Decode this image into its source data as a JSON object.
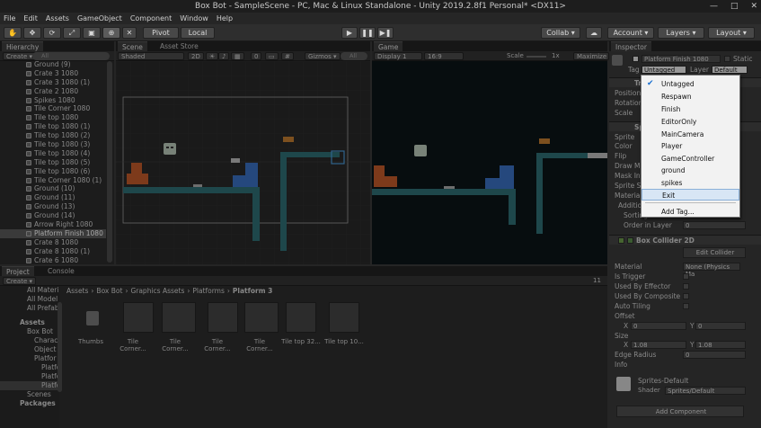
{
  "window": {
    "title": "Box Bot - SampleScene - PC, Mac & Linux Standalone - Unity 2019.2.8f1 Personal* <DX11>",
    "controls": [
      "—",
      "□",
      "✕"
    ]
  },
  "menu": [
    "File",
    "Edit",
    "Assets",
    "GameObject",
    "Component",
    "Window",
    "Help"
  ],
  "toolbar": {
    "pivot": "Pivot",
    "local": "Local",
    "collab": "Collab ▾",
    "account": "Account ▾",
    "layers": "Layers ▾",
    "layout": "Layout ▾",
    "cloud_icon": "cloud-icon"
  },
  "hierarchy": {
    "tab": "Hierarchy",
    "create": "Create ▾",
    "search_placeholder": "All",
    "items": [
      "Ground (9)",
      "Crate 3 1080",
      "Crate 3 1080 (1)",
      "Crate 2 1080",
      "Spikes 1080",
      "Tile Corner 1080",
      "Tile top 1080",
      "Tile top 1080 (1)",
      "Tile top 1080 (2)",
      "Tile top 1080 (3)",
      "Tile top 1080 (4)",
      "Tile top 1080 (5)",
      "Tile top 1080 (6)",
      "Tile Corner 1080 (1)",
      "Ground (10)",
      "Ground (11)",
      "Ground (13)",
      "Ground (14)",
      "Arrow Right 1080",
      "Platform Finish 1080",
      "Crate 8 1080",
      "Crate 8 1080 (1)",
      "Crate 6 1080"
    ],
    "selected_index": 19
  },
  "scene": {
    "tab": "Scene",
    "asset_store_tab": "Asset Store",
    "shading": "Shaded",
    "mode_2d": "2D",
    "gizmos": "Gizmos ▾",
    "search_placeholder": "All"
  },
  "game": {
    "tab": "Game",
    "display": "Display 1",
    "aspect": "16:9",
    "scale_label": "Scale",
    "scale_value": "1x",
    "maximize": "Maximize o"
  },
  "inspector": {
    "tab": "Inspector",
    "object_name": "Platform Finish 1080",
    "static_label": "Static",
    "tag_label": "Tag",
    "tag_value": "Untagged",
    "layer_label": "Layer",
    "layer_value": "Default",
    "transform_header": "Tr",
    "transform_rows": [
      "Position",
      "Rotation",
      "Scale"
    ],
    "sprite_header": "Sprit",
    "sprite_rows": [
      "Sprite",
      "Color",
      "Flip",
      "Draw Mo",
      "Mask Int",
      "Sprite S",
      "Material"
    ],
    "additional_label": "Additio",
    "sorting_label": "Sorting",
    "order_label": "Order in Layer",
    "order_value": "0",
    "box_collider_header": "Box Collider 2D",
    "edit_collider": "Edit Collider",
    "material_label": "Material",
    "material_value": "None (Physics Ma",
    "is_trigger": "Is Trigger",
    "used_by_effector": "Used By Effector",
    "used_by_composite": "Used By Composite",
    "auto_tiling": "Auto Tiling",
    "offset_label": "Offset",
    "offset_x": "0",
    "offset_y": "0",
    "size_label": "Size",
    "size_x": "1.08",
    "size_y": "1.08",
    "edge_radius_label": "Edge Radius",
    "edge_radius_value": "0",
    "info_label": "Info",
    "material_name": "Sprites-Default",
    "shader_label": "Shader",
    "shader_value": "Sprites/Default",
    "add_component": "Add Component"
  },
  "tag_dropdown": {
    "items": [
      "Untagged",
      "Respawn",
      "Finish",
      "EditorOnly",
      "MainCamera",
      "Player",
      "GameController",
      "ground",
      "spikes",
      "Exit",
      "Add Tag..."
    ],
    "checked_index": 0,
    "highlighted_index": 9
  },
  "project": {
    "tab": "Project",
    "console_tab": "Console",
    "create": "Create ▾",
    "favorites": [
      "All Materi",
      "All Model",
      "All Prefab"
    ],
    "tree": [
      "Assets",
      "Box Bot",
      "Charac",
      "Object",
      "Platfor",
      "Platfo",
      "Platfo",
      "Platfo",
      "Scenes",
      "Packages"
    ],
    "breadcrumb": [
      "Assets",
      "Box Bot",
      "Graphics Assets",
      "Platforms",
      "Platform 3"
    ],
    "count": "11",
    "assets": [
      "Thumbs",
      "Tile Corner...",
      "Tile Corner...",
      "Tile Corner...",
      "Tile Corner...",
      "Tile top 32...",
      "Tile top 10..."
    ]
  }
}
